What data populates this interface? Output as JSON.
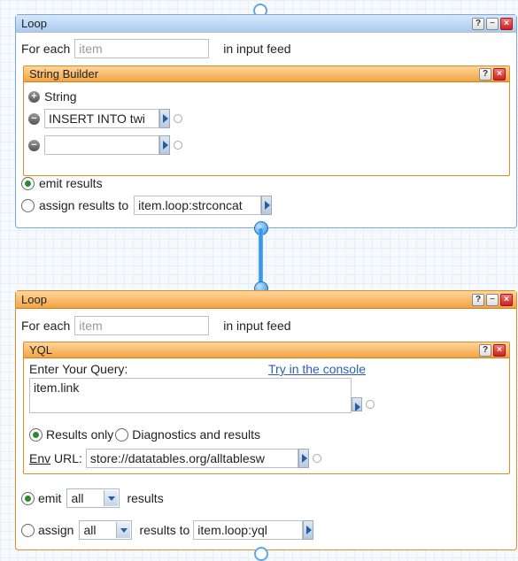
{
  "loop1": {
    "title": "Loop",
    "for_each_label": "For each",
    "item_placeholder": "item",
    "in_feed_label": "in input feed",
    "string_builder": {
      "title": "String Builder",
      "add_label": "String",
      "field1_value": "INSERT INTO twi",
      "field2_value": ""
    },
    "emit_label": "emit results",
    "assign_label": "assign results to",
    "assign_value": "item.loop:strconcat"
  },
  "loop2": {
    "title": "Loop",
    "for_each_label": "For each",
    "item_placeholder": "item",
    "in_feed_label": "in input feed",
    "yql": {
      "title": "YQL",
      "query_label": "Enter Your Query:",
      "console_link": "Try in the console",
      "query_value": "item.link",
      "results_only_label": "Results only",
      "diagnostics_label": "Diagnostics and results",
      "env_label": "Env",
      "url_label": " URL:",
      "env_value": "store://datatables.org/alltablesw"
    },
    "emit_label": "emit",
    "emit_select": "all",
    "emit_results_label": "results",
    "assign_label": "assign",
    "assign_select": "all",
    "assign_results_to_label": "results to",
    "assign_value": "item.loop:yql"
  },
  "title_buttons": {
    "help": "?",
    "minimize": "−",
    "close": "×"
  }
}
